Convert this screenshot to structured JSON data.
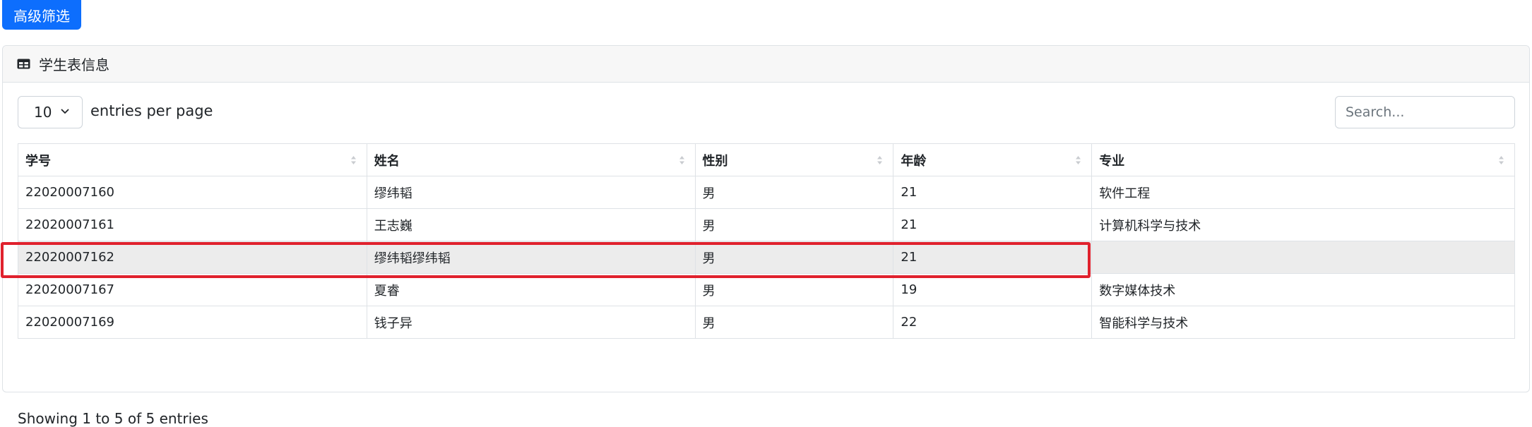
{
  "toolbar": {
    "advanced_filter_label": "高级筛选"
  },
  "card": {
    "title": "学生表信息",
    "title_icon": "table-icon"
  },
  "controls": {
    "per_page_value": "10",
    "per_page_label": "entries per page",
    "search_placeholder": "Search..."
  },
  "table": {
    "headers": [
      "学号",
      "姓名",
      "性别",
      "年龄",
      "专业"
    ],
    "rows": [
      [
        "22020007160",
        "缪纬韬",
        "男",
        "21",
        "软件工程"
      ],
      [
        "22020007161",
        "王志巍",
        "男",
        "21",
        "计算机科学与技术"
      ],
      [
        "22020007162",
        "缪纬韬缪纬韬",
        "男",
        "21",
        ""
      ],
      [
        "22020007167",
        "夏睿",
        "男",
        "19",
        "数字媒体技术"
      ],
      [
        "22020007169",
        "钱子异",
        "男",
        "22",
        "智能科学与技术"
      ]
    ],
    "highlighted_row": 2
  },
  "footer": {
    "info": "Showing 1 to 5 of 5 entries"
  },
  "colors": {
    "primary": "#0d6efd",
    "highlight_border": "#e0212d"
  }
}
